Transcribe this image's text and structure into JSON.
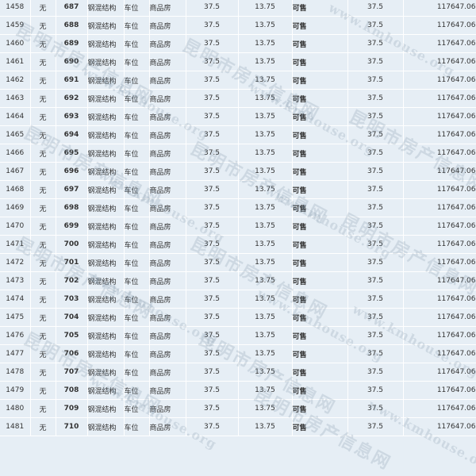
{
  "watermark": {
    "text_cn": "昆明市房产信息网",
    "text_url": "www.kmhouse.org"
  },
  "rows": [
    {
      "seq": "1458",
      "unit": "无",
      "room": "687",
      "struct": "钢混结构",
      "use": "车位",
      "type": "商品房",
      "area": "37.5",
      "inner": "13.75",
      "status": "可售",
      "price": "37.5",
      "total": "117647.06"
    },
    {
      "seq": "1459",
      "unit": "无",
      "room": "688",
      "struct": "钢混结构",
      "use": "车位",
      "type": "商品房",
      "area": "37.5",
      "inner": "13.75",
      "status": "可售",
      "price": "37.5",
      "total": "117647.06"
    },
    {
      "seq": "1460",
      "unit": "无",
      "room": "689",
      "struct": "钢混结构",
      "use": "车位",
      "type": "商品房",
      "area": "37.5",
      "inner": "13.75",
      "status": "可售",
      "price": "37.5",
      "total": "117647.06"
    },
    {
      "seq": "1461",
      "unit": "无",
      "room": "690",
      "struct": "钢混结构",
      "use": "车位",
      "type": "商品房",
      "area": "37.5",
      "inner": "13.75",
      "status": "可售",
      "price": "37.5",
      "total": "117647.06"
    },
    {
      "seq": "1462",
      "unit": "无",
      "room": "691",
      "struct": "钢混结构",
      "use": "车位",
      "type": "商品房",
      "area": "37.5",
      "inner": "13.75",
      "status": "可售",
      "price": "37.5",
      "total": "117647.06"
    },
    {
      "seq": "1463",
      "unit": "无",
      "room": "692",
      "struct": "钢混结构",
      "use": "车位",
      "type": "商品房",
      "area": "37.5",
      "inner": "13.75",
      "status": "可售",
      "price": "37.5",
      "total": "117647.06"
    },
    {
      "seq": "1464",
      "unit": "无",
      "room": "693",
      "struct": "钢混结构",
      "use": "车位",
      "type": "商品房",
      "area": "37.5",
      "inner": "13.75",
      "status": "可售",
      "price": "37.5",
      "total": "117647.06"
    },
    {
      "seq": "1465",
      "unit": "无",
      "room": "694",
      "struct": "钢混结构",
      "use": "车位",
      "type": "商品房",
      "area": "37.5",
      "inner": "13.75",
      "status": "可售",
      "price": "37.5",
      "total": "117647.06"
    },
    {
      "seq": "1466",
      "unit": "无",
      "room": "695",
      "struct": "钢混结构",
      "use": "车位",
      "type": "商品房",
      "area": "37.5",
      "inner": "13.75",
      "status": "可售",
      "price": "37.5",
      "total": "117647.06"
    },
    {
      "seq": "1467",
      "unit": "无",
      "room": "696",
      "struct": "钢混结构",
      "use": "车位",
      "type": "商品房",
      "area": "37.5",
      "inner": "13.75",
      "status": "可售",
      "price": "37.5",
      "total": "117647.06"
    },
    {
      "seq": "1468",
      "unit": "无",
      "room": "697",
      "struct": "钢混结构",
      "use": "车位",
      "type": "商品房",
      "area": "37.5",
      "inner": "13.75",
      "status": "可售",
      "price": "37.5",
      "total": "117647.06"
    },
    {
      "seq": "1469",
      "unit": "无",
      "room": "698",
      "struct": "钢混结构",
      "use": "车位",
      "type": "商品房",
      "area": "37.5",
      "inner": "13.75",
      "status": "可售",
      "price": "37.5",
      "total": "117647.06"
    },
    {
      "seq": "1470",
      "unit": "无",
      "room": "699",
      "struct": "钢混结构",
      "use": "车位",
      "type": "商品房",
      "area": "37.5",
      "inner": "13.75",
      "status": "可售",
      "price": "37.5",
      "total": "117647.06"
    },
    {
      "seq": "1471",
      "unit": "无",
      "room": "700",
      "struct": "钢混结构",
      "use": "车位",
      "type": "商品房",
      "area": "37.5",
      "inner": "13.75",
      "status": "可售",
      "price": "37.5",
      "total": "117647.06"
    },
    {
      "seq": "1472",
      "unit": "无",
      "room": "701",
      "struct": "钢混结构",
      "use": "车位",
      "type": "商品房",
      "area": "37.5",
      "inner": "13.75",
      "status": "可售",
      "price": "37.5",
      "total": "117647.06"
    },
    {
      "seq": "1473",
      "unit": "无",
      "room": "702",
      "struct": "钢混结构",
      "use": "车位",
      "type": "商品房",
      "area": "37.5",
      "inner": "13.75",
      "status": "可售",
      "price": "37.5",
      "total": "117647.06"
    },
    {
      "seq": "1474",
      "unit": "无",
      "room": "703",
      "struct": "钢混结构",
      "use": "车位",
      "type": "商品房",
      "area": "37.5",
      "inner": "13.75",
      "status": "可售",
      "price": "37.5",
      "total": "117647.06"
    },
    {
      "seq": "1475",
      "unit": "无",
      "room": "704",
      "struct": "钢混结构",
      "use": "车位",
      "type": "商品房",
      "area": "37.5",
      "inner": "13.75",
      "status": "可售",
      "price": "37.5",
      "total": "117647.06"
    },
    {
      "seq": "1476",
      "unit": "无",
      "room": "705",
      "struct": "钢混结构",
      "use": "车位",
      "type": "商品房",
      "area": "37.5",
      "inner": "13.75",
      "status": "可售",
      "price": "37.5",
      "total": "117647.06"
    },
    {
      "seq": "1477",
      "unit": "无",
      "room": "706",
      "struct": "钢混结构",
      "use": "车位",
      "type": "商品房",
      "area": "37.5",
      "inner": "13.75",
      "status": "可售",
      "price": "37.5",
      "total": "117647.06"
    },
    {
      "seq": "1478",
      "unit": "无",
      "room": "707",
      "struct": "钢混结构",
      "use": "车位",
      "type": "商品房",
      "area": "37.5",
      "inner": "13.75",
      "status": "可售",
      "price": "37.5",
      "total": "117647.06"
    },
    {
      "seq": "1479",
      "unit": "无",
      "room": "708",
      "struct": "钢混结构",
      "use": "车位",
      "type": "商品房",
      "area": "37.5",
      "inner": "13.75",
      "status": "可售",
      "price": "37.5",
      "total": "117647.06"
    },
    {
      "seq": "1480",
      "unit": "无",
      "room": "709",
      "struct": "钢混结构",
      "use": "车位",
      "type": "商品房",
      "area": "37.5",
      "inner": "13.75",
      "status": "可售",
      "price": "37.5",
      "total": "117647.06"
    },
    {
      "seq": "1481",
      "unit": "无",
      "room": "710",
      "struct": "钢混结构",
      "use": "车位",
      "type": "商品房",
      "area": "37.5",
      "inner": "13.75",
      "status": "可售",
      "price": "37.5",
      "total": "117647.06"
    }
  ],
  "colors": {
    "background": "#e6eef5",
    "room_link": "#2a3fa0",
    "status_available": "#1a7a1a"
  }
}
